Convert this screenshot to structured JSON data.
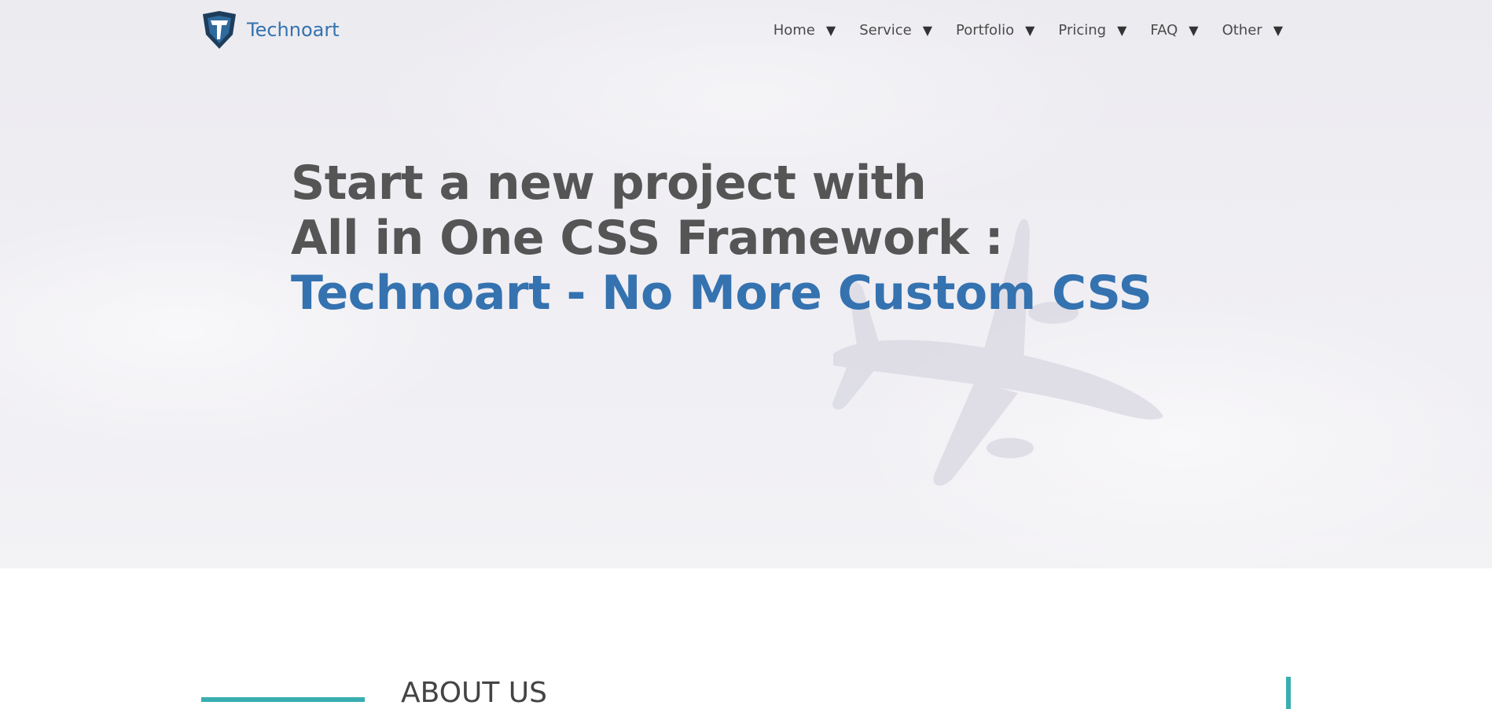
{
  "brand": {
    "name": "Technoart",
    "logo_icon": "shield-t-logo-icon"
  },
  "nav": {
    "items": [
      {
        "label": "Home",
        "caret": "▼"
      },
      {
        "label": "Service",
        "caret": "▼"
      },
      {
        "label": "Portfolio",
        "caret": "▼"
      },
      {
        "label": "Pricing",
        "caret": "▼"
      },
      {
        "label": "FAQ",
        "caret": "▼"
      },
      {
        "label": "Other",
        "caret": "▼"
      }
    ]
  },
  "hero": {
    "line1": "Start a new project with",
    "line2": "All in One CSS Framework :",
    "line3": "Technoart - No More Custom CSS",
    "background_image": "airplane-in-clouds"
  },
  "about": {
    "title": "ABOUT US"
  },
  "colors": {
    "accent": "#3572b0",
    "teal": "#39aeb0",
    "heading": "#555555"
  }
}
